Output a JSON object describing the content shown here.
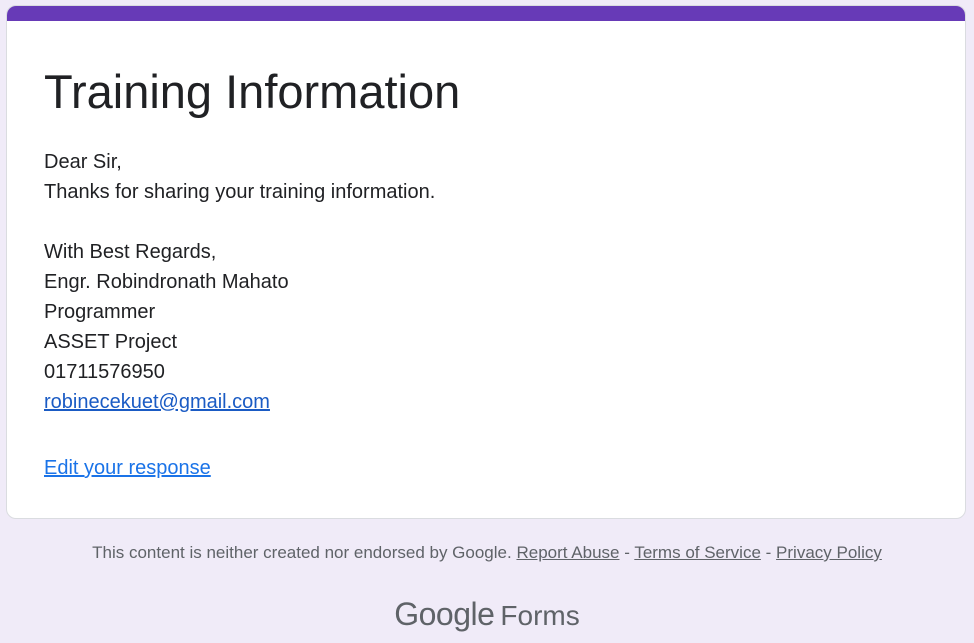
{
  "form": {
    "title": "Training Information",
    "message": {
      "greeting": "Dear Sir,",
      "thanks": "Thanks for sharing your training information.",
      "closing": "With Best Regards,",
      "name": "Engr. Robindronath Mahato",
      "role": "Programmer",
      "project": "ASSET Project",
      "phone": "01711576950",
      "email": "robinecekuet@gmail.com"
    },
    "edit_response_label": "Edit your response"
  },
  "footer": {
    "disclaimer": "This content is neither created nor endorsed by Google.",
    "report_abuse": "Report Abuse",
    "separator": "-",
    "terms": "Terms of Service",
    "privacy": "Privacy Policy"
  },
  "brand": {
    "logo_text": "Google",
    "product": "Forms"
  },
  "colors": {
    "accent": "#673ab7",
    "background": "#f0ebf8",
    "link": "#1a73e8"
  }
}
